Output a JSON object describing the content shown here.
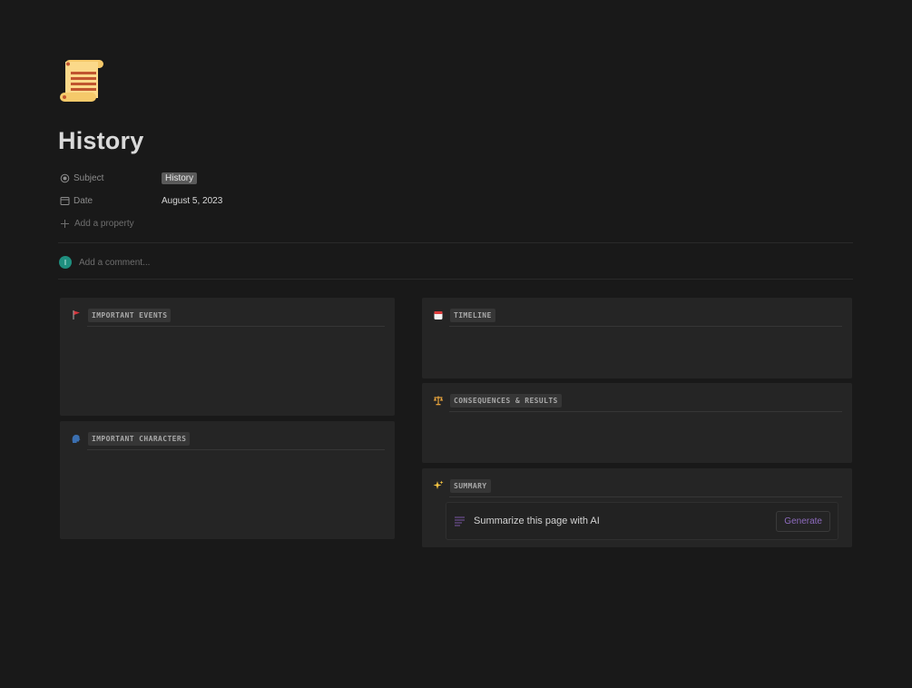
{
  "page": {
    "icon": "scroll-icon",
    "title": "History"
  },
  "properties": [
    {
      "name": "Subject",
      "icon": "status-icon",
      "value": "History",
      "type": "tag"
    },
    {
      "name": "Date",
      "icon": "calendar-icon",
      "value": "August 5, 2023",
      "type": "text"
    }
  ],
  "add_property": "Add a property",
  "comment": {
    "avatar_initial": "I",
    "placeholder": "Add a comment..."
  },
  "sections": {
    "important_events": {
      "icon": "red-flag-icon",
      "label": "IMPORTANT EVENTS"
    },
    "important_characters": {
      "icon": "speaking-head-icon",
      "label": "IMPORTANT CHARACTERS"
    },
    "timeline": {
      "icon": "calendar-icon",
      "label": "TIMELINE"
    },
    "consequences": {
      "icon": "balance-scale-icon",
      "label": "CONSEQUENCES & RESULTS"
    },
    "summary": {
      "icon": "sparkles-icon",
      "label": "SUMMARY"
    }
  },
  "ai_summary": {
    "text": "Summarize this page with AI",
    "button": "Generate"
  },
  "colors": {
    "background": "#191919",
    "card": "#252525",
    "accent_purple": "#8e6bbf",
    "avatar": "#1f8f7f"
  }
}
